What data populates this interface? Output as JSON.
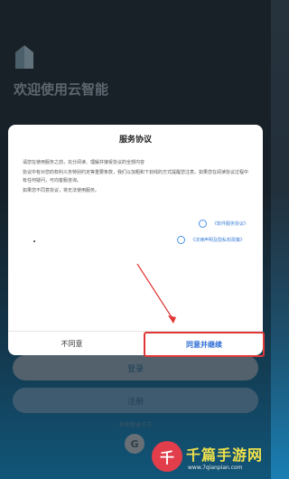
{
  "app": {
    "welcome_title": "欢迎使用云智能"
  },
  "bottom": {
    "login_label": "登录",
    "register_label": "注册",
    "other_login_label": "其他登录方式",
    "google_label": "G"
  },
  "dialog": {
    "title": "服务协议",
    "paragraphs": [
      "请您在使用服务之前，充分阅读、理解并接受协议的全部内容",
      "协议中有对您的权利义务特别约定等重要条款，我们以加粗和下划线的方式提醒您注意。如果您在阅读协议过程中有任何疑问，可向客服咨询。",
      "如果您不同意协议，将无法使用服务。"
    ],
    "link1": "《软件服务协议》",
    "link2": "《法律声明及隐私权政策》",
    "disagree_label": "不同意",
    "agree_label": "同意并继续"
  },
  "watermark": {
    "text": "千篇手游网",
    "url": "www.7qianpian.com"
  },
  "colors": {
    "annotation": "#e03838",
    "link": "#3b7fd6"
  }
}
